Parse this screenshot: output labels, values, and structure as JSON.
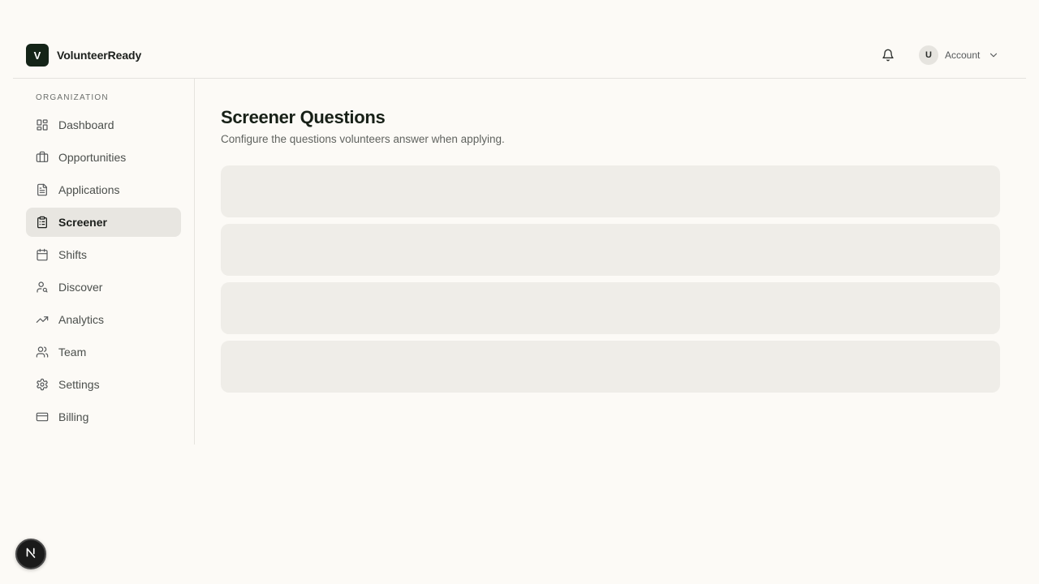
{
  "brand": {
    "logo_letter": "V",
    "name": "VolunteerReady"
  },
  "header": {
    "notifications_icon": "bell-icon",
    "account": {
      "avatar_letter": "U",
      "label": "Account",
      "menu_icon": "chevron-down-icon"
    }
  },
  "sidebar": {
    "section_label": "ORGANIZATION",
    "items": [
      {
        "label": "Dashboard",
        "icon": "dashboard-icon",
        "active": false
      },
      {
        "label": "Opportunities",
        "icon": "briefcase-icon",
        "active": false
      },
      {
        "label": "Applications",
        "icon": "document-icon",
        "active": false
      },
      {
        "label": "Screener",
        "icon": "clipboard-icon",
        "active": true
      },
      {
        "label": "Shifts",
        "icon": "calendar-icon",
        "active": false
      },
      {
        "label": "Discover",
        "icon": "user-search-icon",
        "active": false
      },
      {
        "label": "Analytics",
        "icon": "trending-up-icon",
        "active": false
      },
      {
        "label": "Team",
        "icon": "users-icon",
        "active": false
      },
      {
        "label": "Settings",
        "icon": "gear-icon",
        "active": false
      },
      {
        "label": "Billing",
        "icon": "credit-card-icon",
        "active": false
      }
    ]
  },
  "main": {
    "title": "Screener Questions",
    "subtitle": "Configure the questions volunteers answer when applying.",
    "loading_placeholder_count": 4
  },
  "dev_badge": {
    "letter": "N",
    "icon": "nextjs-icon"
  },
  "colors": {
    "background": "#fcfaf6",
    "brand": "#142418",
    "active_item": "#e8e6e1",
    "skeleton": "#efede8",
    "border": "#e5e3de"
  }
}
